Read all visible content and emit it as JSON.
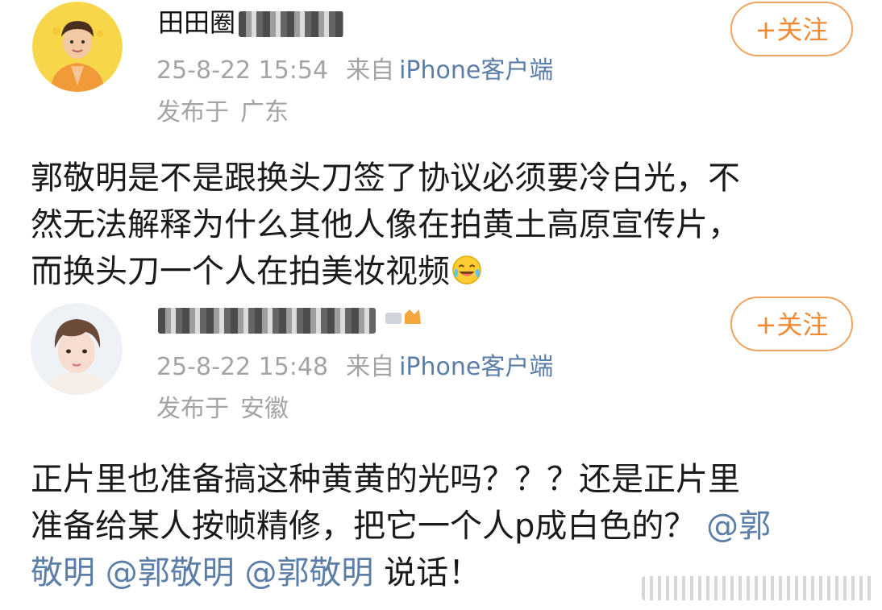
{
  "posts": [
    {
      "username": "田田圈",
      "time": "25-8-22 15:54",
      "from_label": "来自",
      "client": "iPhone客户端",
      "location_prefix": "发布于",
      "location": "广东",
      "follow_label": "+关注",
      "body_lines": [
        "郭敬明是不是跟换头刀签了协议必须要冷白光，不",
        "然无法解释为什么其他人像在拍黄土高原宣传片，",
        "而换头刀一个人在拍美妆视频"
      ]
    },
    {
      "username": "",
      "time": "25-8-22 15:48",
      "from_label": "来自",
      "client": "iPhone客户端",
      "location_prefix": "发布于",
      "location": "安徽",
      "follow_label": "+关注",
      "body_line1": "正片里也准备搞这种黄黄的光吗？？？还是正片里",
      "body_line2_text": "准备给某人按帧精修，把它一个人p成白色的？",
      "mention_1": "@郭",
      "mention_2": "敬明",
      "mention_3": "@郭敬明",
      "mention_4": "@郭敬明",
      "tail": "说话！"
    }
  ],
  "colors": {
    "follow_orange": "#f08a33",
    "link_blue": "#5b7ea8",
    "meta_gray": "#a4a4a4"
  },
  "icons": {
    "emoji": "laughing-crying-emoji",
    "badge": "crown-badge-icon"
  }
}
